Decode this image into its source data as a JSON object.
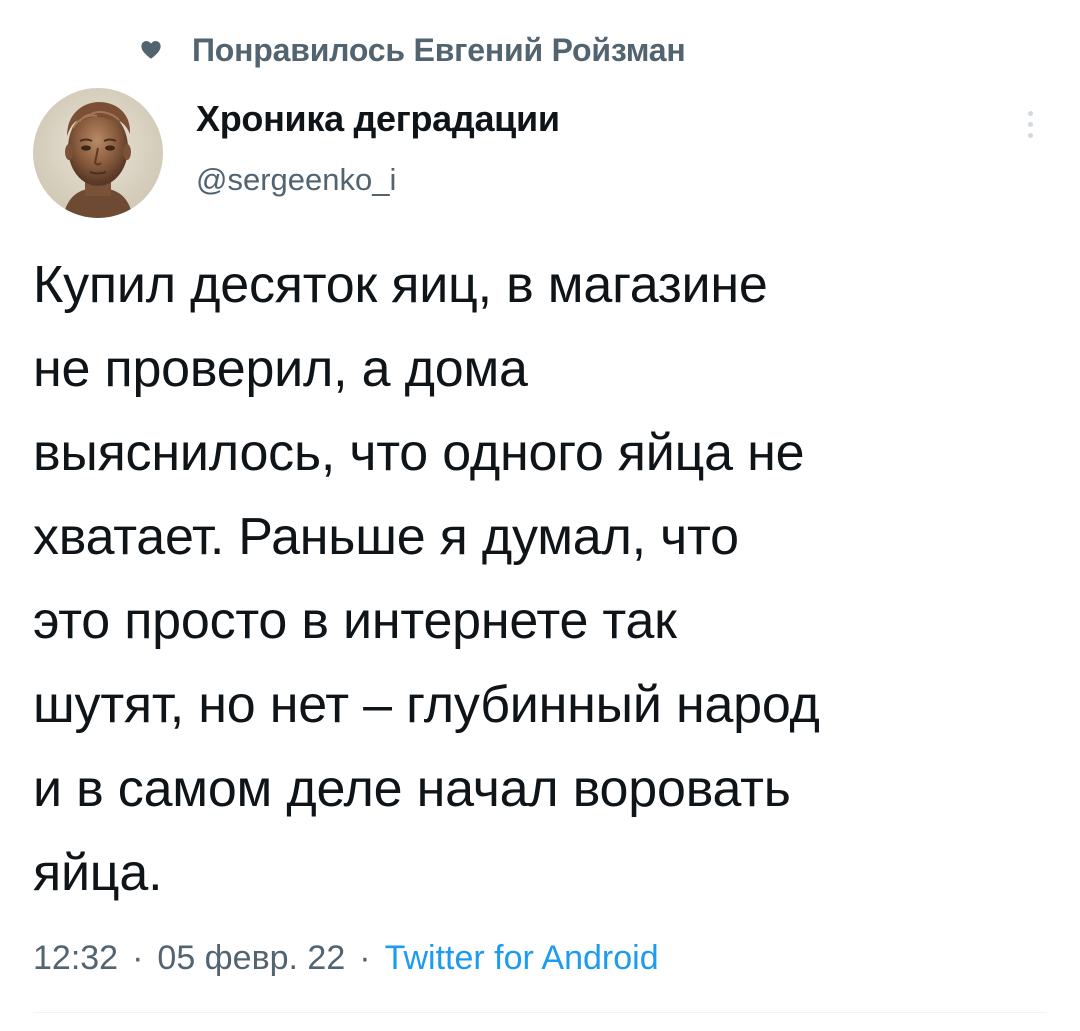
{
  "social_context": {
    "icon": "heart-icon",
    "text": "Понравилось Евгений Ройзман"
  },
  "author": {
    "avatar": "avatar",
    "name": "Хроника деградации",
    "handle": "@sergeenko_i"
  },
  "more_button": {
    "icon": "more-vertical-icon"
  },
  "tweet": {
    "lines": [
      "Купил десяток яиц, в магазине",
      "не проверил, а дома",
      "выяснилось, что одного яйца не",
      "хватает. Раньше я думал, что",
      "это просто в интернете так",
      "шутят, но нет – глубинный народ",
      "и в самом деле начал воровать",
      "яйца."
    ]
  },
  "meta": {
    "time": "12:32",
    "separator": "·",
    "date": "05 февр. 22",
    "source": "Twitter for Android"
  },
  "colors": {
    "text": "#0f1419",
    "secondary": "#536471",
    "link": "#1d9bf0",
    "divider": "#eff3f4"
  }
}
